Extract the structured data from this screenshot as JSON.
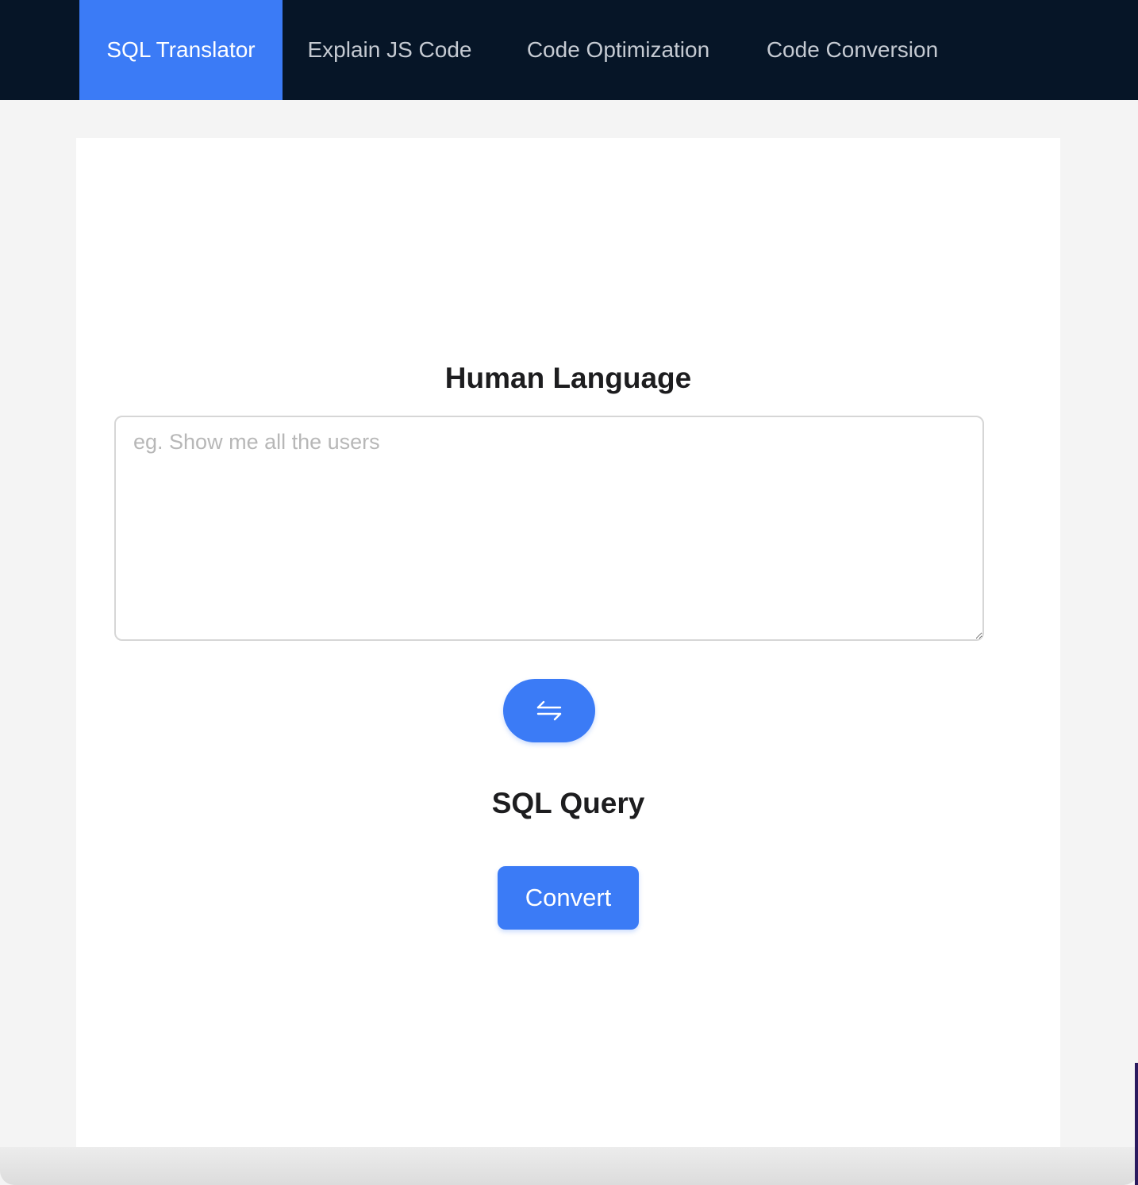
{
  "nav": {
    "tabs": [
      {
        "label": "SQL Translator",
        "active": true
      },
      {
        "label": "Explain JS Code",
        "active": false
      },
      {
        "label": "Code Optimization",
        "active": false
      },
      {
        "label": "Code Conversion",
        "active": false
      }
    ]
  },
  "main": {
    "human_heading": "Human Language",
    "input": {
      "placeholder": "eg. Show me all the users",
      "value": ""
    },
    "swap_icon": "swap-arrows-icon",
    "sql_heading": "SQL Query",
    "convert_label": "Convert"
  },
  "colors": {
    "topbar_bg": "#061527",
    "accent": "#3b7bf6",
    "page_bg": "#f4f4f4",
    "card_bg": "#ffffff"
  }
}
